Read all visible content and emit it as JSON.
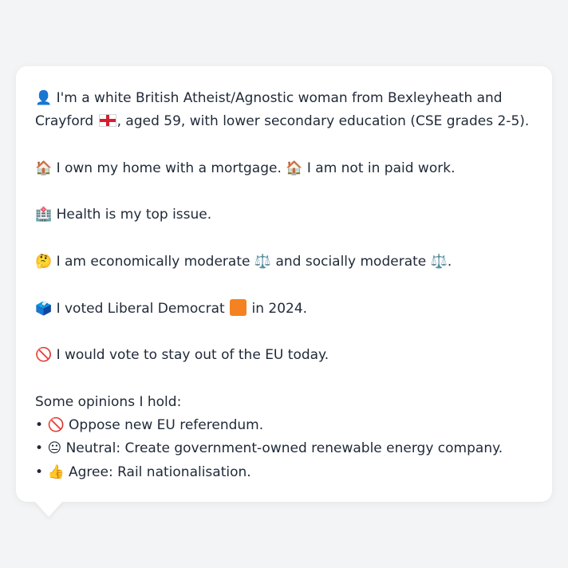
{
  "persona": {
    "intro_icon": "👤",
    "intro_text_a": "I'm a white British Atheist/Agnostic woman from Bexleyheath and Crayford",
    "intro_flag": "england-flag",
    "intro_text_b": ", aged 59, with lower secondary education (CSE grades 2-5).",
    "home_icon": "🏠",
    "home_text_a": "I own my home with a mortgage.",
    "work_icon": "🏠",
    "work_text": "I am not in paid work.",
    "health_icon": "🏥",
    "health_text": "Health is my top issue.",
    "ideology_icon": "🤔",
    "ideology_text_a": "I am economically moderate",
    "scale_icon_1": "⚖️",
    "ideology_text_b": "and socially moderate",
    "scale_icon_2": "⚖️",
    "ideology_text_c": ".",
    "vote_icon": "🗳️",
    "vote_text_a": "I voted Liberal Democrat",
    "party_color": "#f58220",
    "vote_text_b": "in 2024.",
    "eu_icon": "🚫",
    "eu_text": "I would vote to stay out of the EU today.",
    "opinions_heading": "Some opinions I hold:",
    "opinions": [
      {
        "bullet": "•",
        "icon": "🚫",
        "text": "Oppose new EU referendum."
      },
      {
        "bullet": "•",
        "icon": "😐",
        "text": "Neutral: Create government-owned renewable energy company."
      },
      {
        "bullet": "•",
        "icon": "👍",
        "text": "Agree: Rail nationalisation."
      }
    ]
  }
}
